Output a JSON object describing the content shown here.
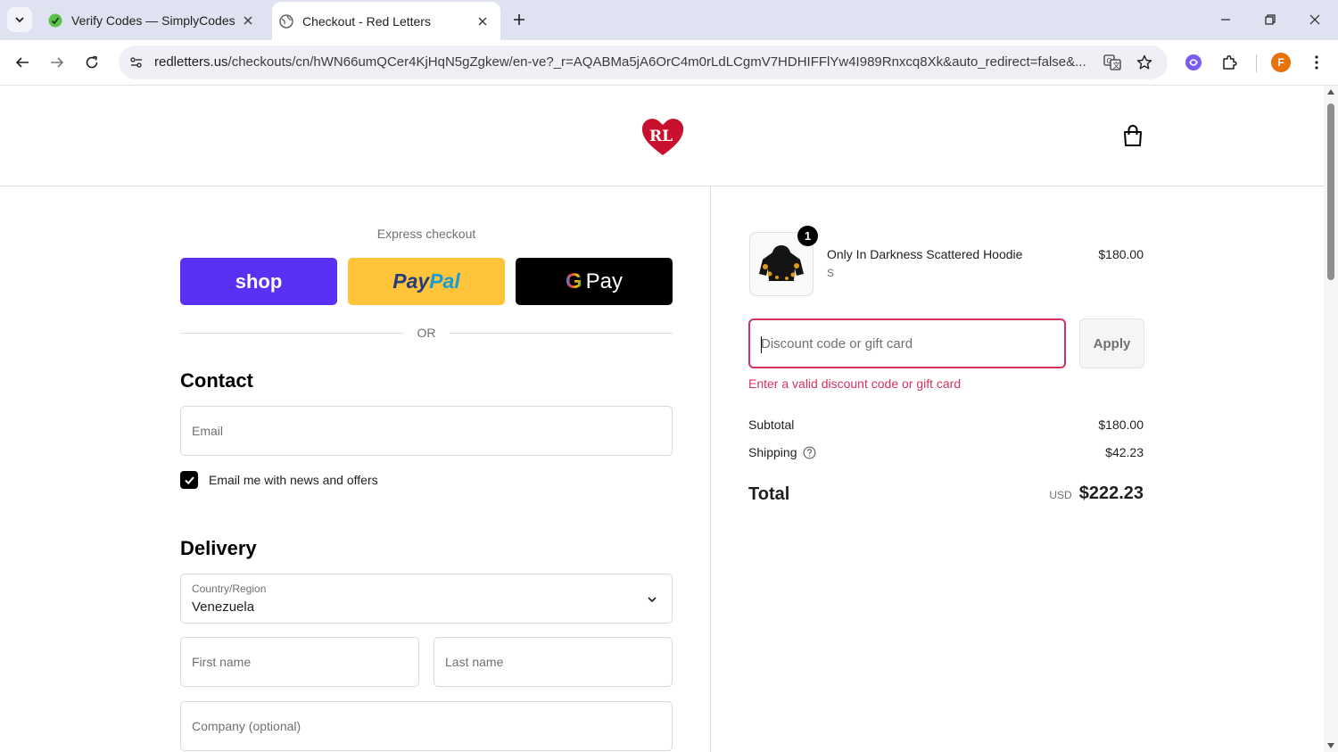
{
  "browser": {
    "tabs": [
      {
        "title": "Verify Codes — SimplyCodes",
        "active": false,
        "favicon": "simplycodes-icon"
      },
      {
        "title": "Checkout - Red Letters",
        "active": true,
        "favicon": "globe-icon"
      }
    ],
    "url_host": "redletters.us",
    "url_path": "/checkouts/cn/hWN66umQCer4KjHqN5gZgkew/en-ve?_r=AQABMa5jA6OrC4m0rLdLCgmV7HDHIFFlYw4I989Rnxcq8Xk&auto_redirect=false&...",
    "profile_initial": "F",
    "colors": {
      "tabbar": "#dfe3f1",
      "omnibox": "#eef0f6",
      "profile": "#e8710a"
    }
  },
  "header": {
    "logo_text": "RL",
    "logo_color": "#c8102e"
  },
  "express": {
    "label": "Express checkout",
    "shop_label": "shop",
    "paypal_pay": "Pay",
    "paypal_pal": "Pal",
    "gpay_g": "G",
    "gpay_label": "Pay",
    "or_label": "OR",
    "colors": {
      "shop": "#5a31f4",
      "paypal": "#ffc439",
      "gpay": "#000000"
    }
  },
  "contact": {
    "title": "Contact",
    "email_placeholder": "Email",
    "email_value": "",
    "newsletter_label": "Email me with news and offers",
    "newsletter_checked": true
  },
  "delivery": {
    "title": "Delivery",
    "country_label": "Country/Region",
    "country_value": "Venezuela",
    "first_name_placeholder": "First name",
    "last_name_placeholder": "Last name",
    "company_placeholder": "Company (optional)"
  },
  "summary": {
    "item": {
      "name": "Only In Darkness Scattered Hoodie",
      "variant": "S",
      "price": "$180.00",
      "quantity": "1"
    },
    "discount_placeholder": "Discount code or gift card",
    "discount_value": "",
    "apply_label": "Apply",
    "error": "Enter a valid discount code or gift card",
    "subtotal_label": "Subtotal",
    "subtotal_value": "$180.00",
    "shipping_label": "Shipping",
    "shipping_value": "$42.23",
    "total_label": "Total",
    "currency": "USD",
    "total_value": "$222.23",
    "colors": {
      "error": "#d0345d"
    }
  }
}
